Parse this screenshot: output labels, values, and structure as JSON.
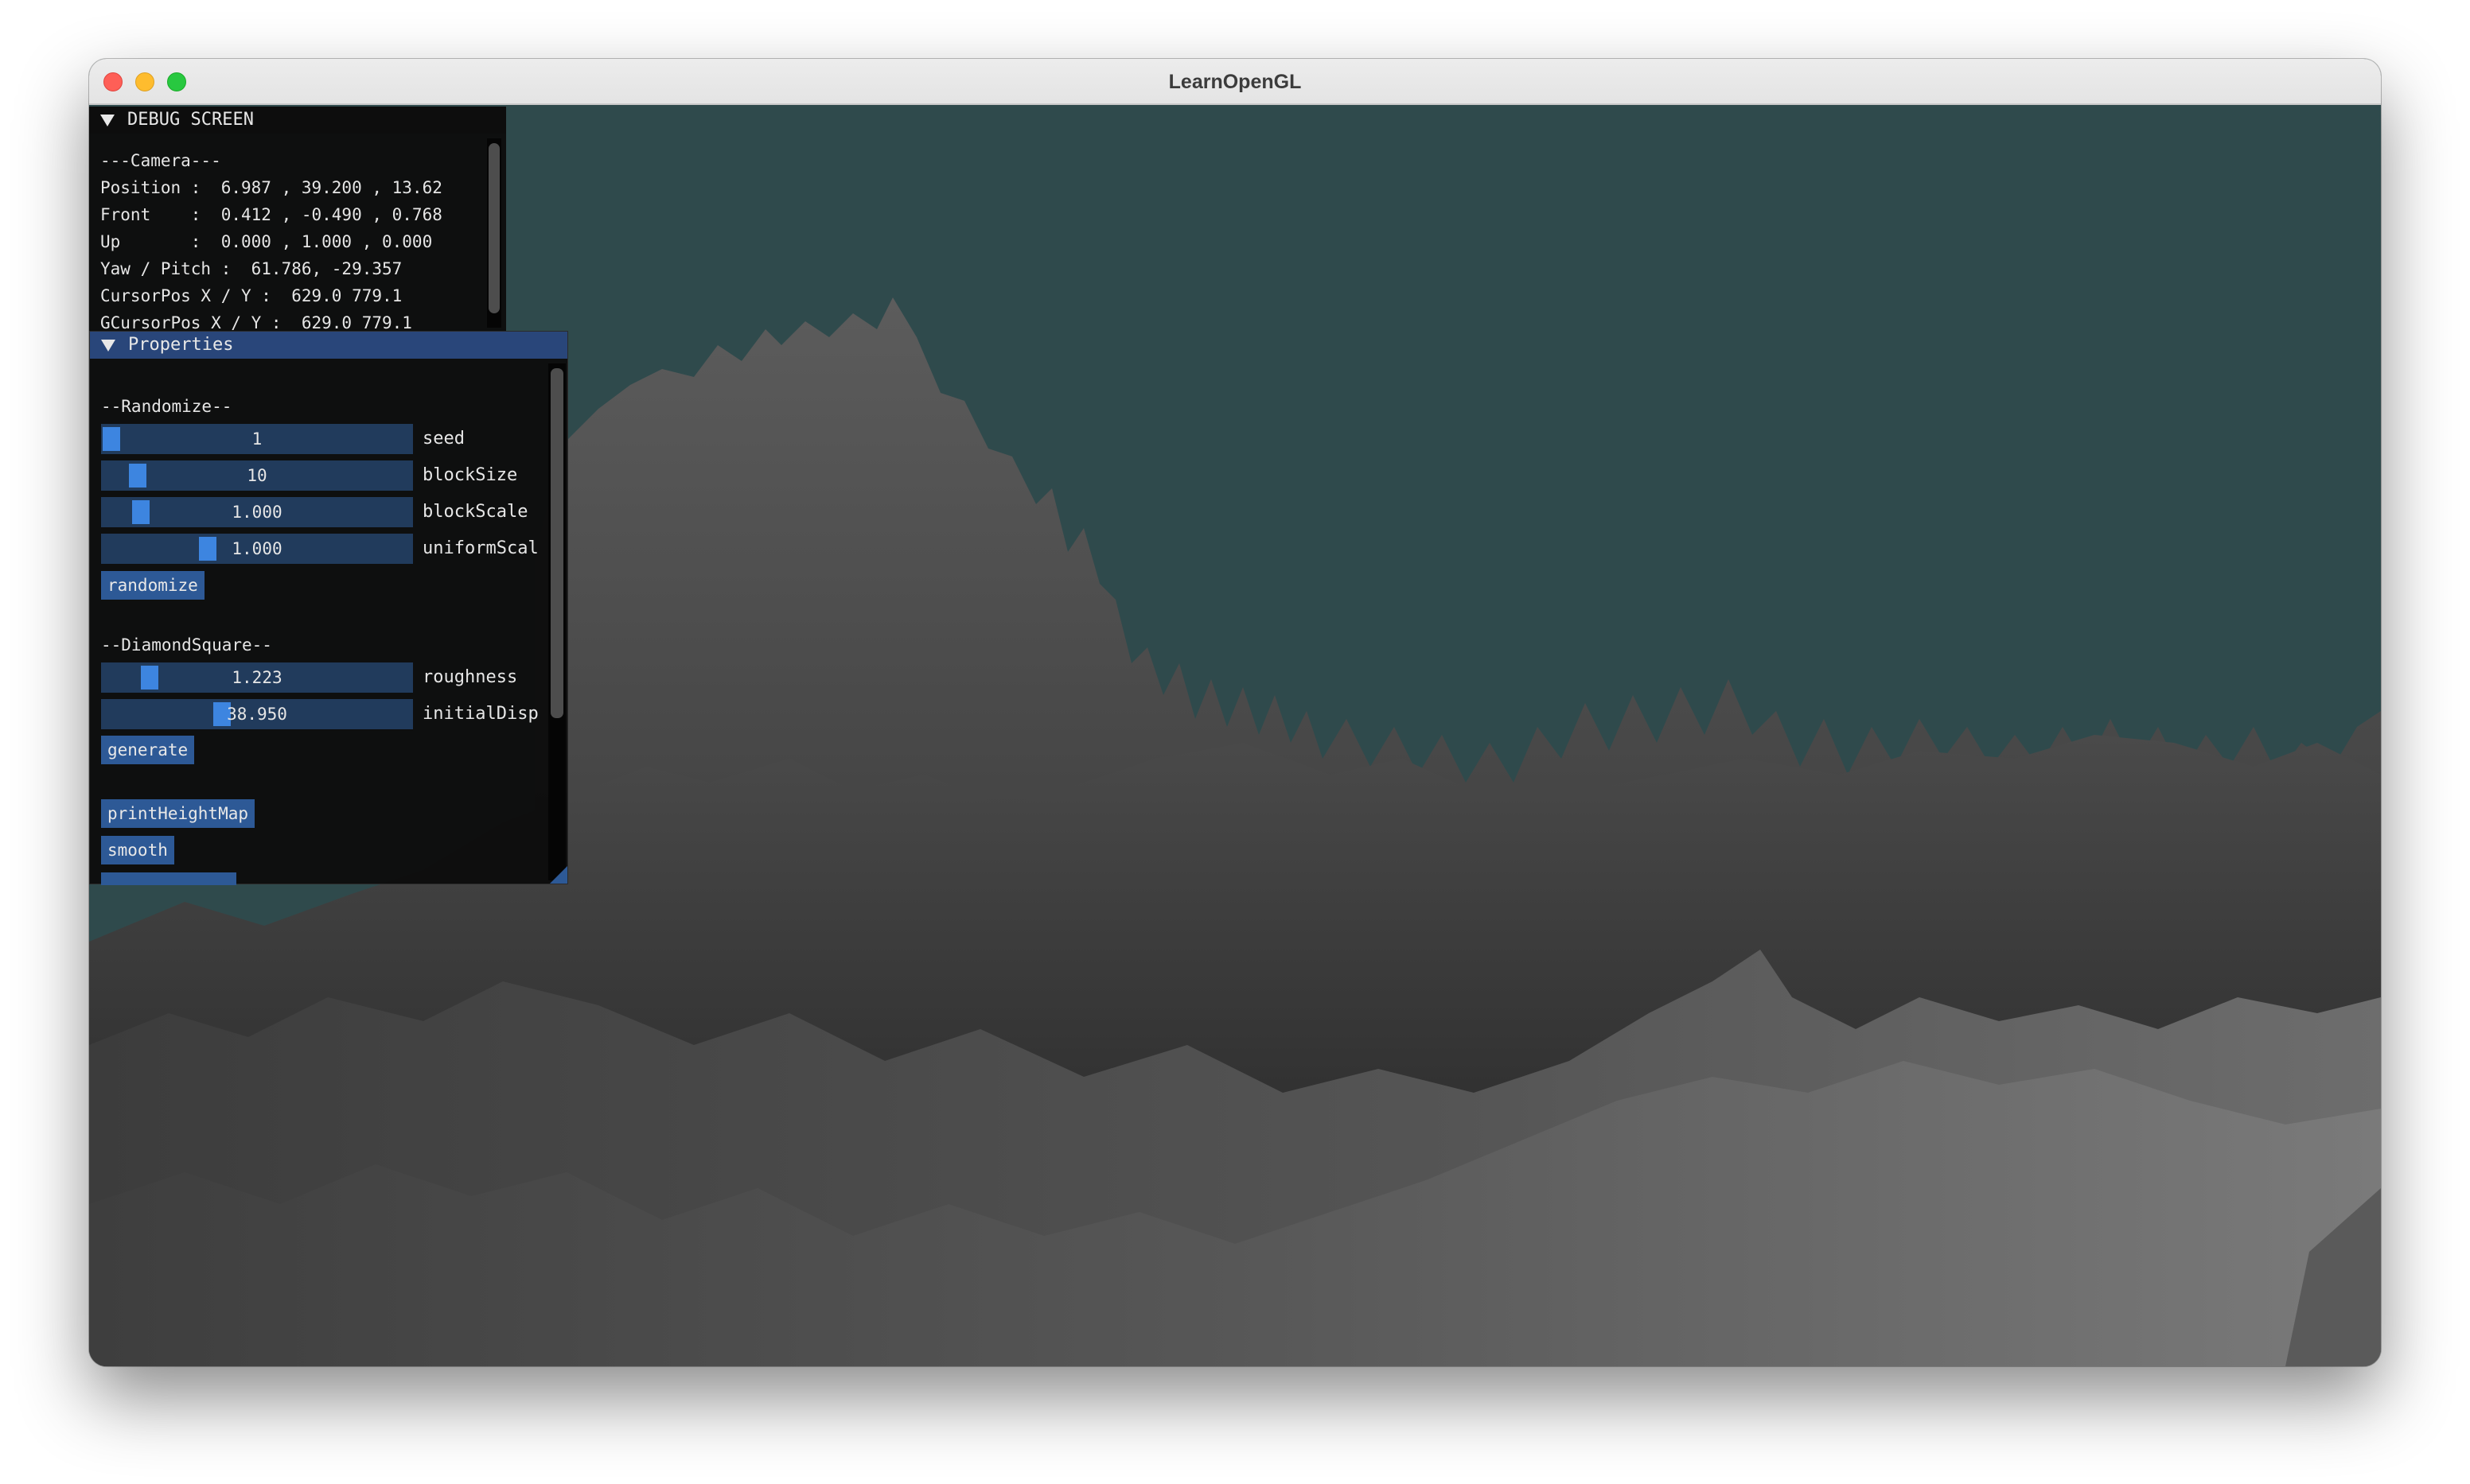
{
  "window": {
    "title": "LearnOpenGL",
    "background_color": "#2f4a4c",
    "controls": [
      "close",
      "minimize",
      "zoom"
    ]
  },
  "debug_panel": {
    "header": "DEBUG SCREEN",
    "lines": [
      "---Camera---",
      "Position :  6.987 , 39.200 , 13.62",
      "Front    :  0.412 , -0.490 , 0.768",
      "Up       :  0.000 , 1.000 , 0.000",
      "Yaw / Pitch :  61.786, -29.357",
      "CursorPos X / Y :  629.0 779.1",
      "GCursorPos X / Y :  629.0 779.1"
    ]
  },
  "properties_panel": {
    "header": "Properties",
    "randomize_label": "--Randomize--",
    "sliders_randomize": [
      {
        "label": "seed",
        "value": "1",
        "fraction": 0.0
      },
      {
        "label": "blockSize",
        "value": "10",
        "fraction": 0.09
      },
      {
        "label": "blockScale",
        "value": "1.000",
        "fraction": 0.1
      },
      {
        "label": "uniformScal",
        "value": "1.000",
        "fraction": 0.33
      }
    ],
    "randomize_button": "randomize",
    "diamond_label": "--DiamondSquare--",
    "sliders_diamond": [
      {
        "label": "roughness",
        "value": "1.223",
        "fraction": 0.13
      },
      {
        "label": "initialDisp",
        "value": "38.950",
        "fraction": 0.38
      }
    ],
    "generate_button": "generate",
    "print_button": "printHeightMap",
    "smooth_button": "smooth",
    "accent_color": "#3d85e0",
    "header_color": "#29467a"
  }
}
